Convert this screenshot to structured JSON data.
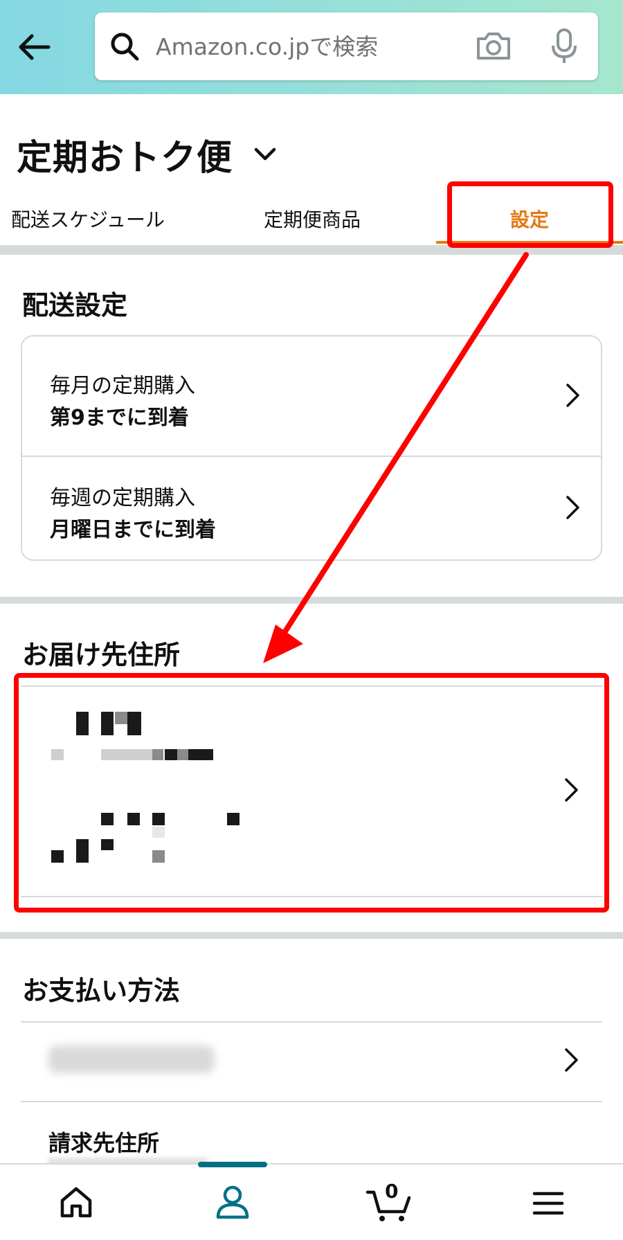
{
  "search": {
    "placeholder": "Amazon.co.jpで検索"
  },
  "page": {
    "title": "定期おトク便"
  },
  "tabs": [
    {
      "label": "配送スケジュール"
    },
    {
      "label": "定期便商品"
    },
    {
      "label": "設定",
      "active": true
    }
  ],
  "delivery_settings": {
    "title": "配送設定",
    "rows": [
      {
        "label": "毎月の定期購入",
        "value": "第9までに到着"
      },
      {
        "label": "毎週の定期購入",
        "value": "月曜日までに到着"
      }
    ]
  },
  "address": {
    "title": "お届け先住所"
  },
  "payment": {
    "title": "お支払い方法",
    "billing_label": "請求先住所"
  },
  "cart": {
    "count": "0"
  },
  "colors": {
    "accent": "#e47911",
    "annotation": "#ff0000",
    "teal": "#007185"
  },
  "icons": [
    "back-arrow-icon",
    "search-icon",
    "camera-icon",
    "mic-icon",
    "chevron-down-icon",
    "chevron-right-icon",
    "home-icon",
    "account-icon",
    "cart-icon",
    "menu-icon"
  ]
}
